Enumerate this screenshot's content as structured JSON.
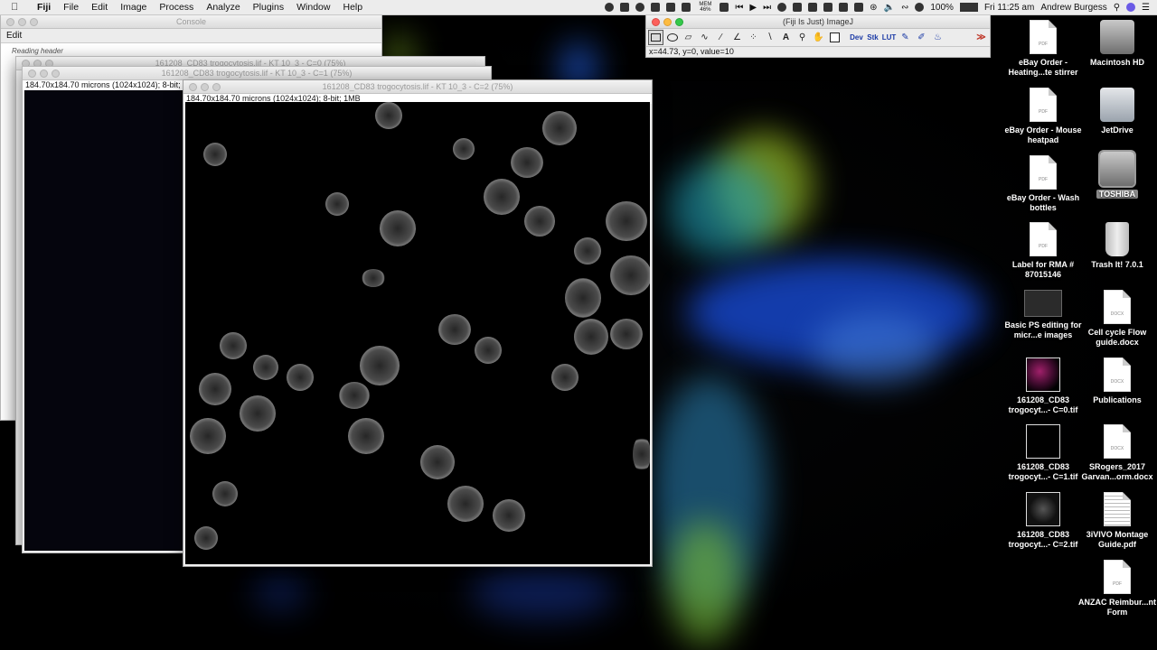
{
  "menubar": {
    "app": "Fiji",
    "menus": [
      "File",
      "Edit",
      "Image",
      "Process",
      "Analyze",
      "Plugins",
      "Window",
      "Help"
    ],
    "memory": "MEM 46%",
    "battery": "100%",
    "clock": "Fri 11:25 am",
    "user": "Andrew Burgess"
  },
  "console": {
    "title": "Console",
    "menu": "Edit",
    "line1": "Reading header"
  },
  "image_windows": [
    {
      "title": "161208_CD83 trogocytosis.lif - KT 10_3 - C=0 (75%)"
    },
    {
      "title": "161208_CD83 trogocytosis.lif - KT 10_3 - C=1 (75%)",
      "info": "184.70x184.70 microns (1024x1024); 8-bit; 1MB"
    },
    {
      "title": "161208_CD83 trogocytosis.lif - KT 10_3 - C=2 (75%)",
      "info": "184.70x184.70 microns (1024x1024); 8-bit; 1MB"
    }
  ],
  "imagej": {
    "title": "(Fiji Is Just) ImageJ",
    "tool_dev": "Dev",
    "tool_stk": "Stk",
    "tool_lut": "LUT",
    "more": "≫",
    "status": "x=44.73, y=0, value=10"
  },
  "desktop_icons": [
    {
      "label": "eBay Order - Heating...te stirrer",
      "ext": "PDF"
    },
    {
      "label": "Macintosh HD"
    },
    {
      "label": "eBay Order - Mouse heatpad",
      "ext": "PDF"
    },
    {
      "label": "JetDrive"
    },
    {
      "label": "eBay Order - Wash bottles",
      "ext": "PDF"
    },
    {
      "label": "TOSHIBA"
    },
    {
      "label": "Label for RMA # 87015146",
      "ext": "PDF"
    },
    {
      "label": "Trash It! 7.0.1"
    },
    {
      "label": "Basic PS editing for micr...e images"
    },
    {
      "label": "Cell cycle Flow guide.docx",
      "ext": "DOCX"
    },
    {
      "label": "161208_CD83 trogocyt...- C=0.tif"
    },
    {
      "label": "Publications",
      "ext": "DOCX"
    },
    {
      "label": "161208_CD83 trogocyt...- C=1.tif"
    },
    {
      "label": "SRogers_2017 Garvan...orm.docx",
      "ext": "DOCX"
    },
    {
      "label": "161208_CD83 trogocyt...- C=2.tif"
    },
    {
      "label": "3iVIVO Montage Guide.pdf"
    },
    {
      "label": "ANZAC Reimbur...nt Form",
      "ext": "PDF"
    }
  ]
}
